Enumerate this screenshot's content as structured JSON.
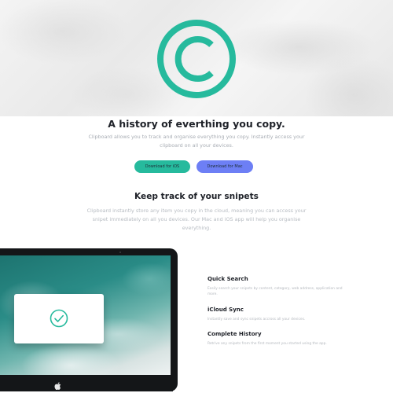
{
  "hero": {
    "logo_icon": "copyright-c-icon",
    "accent": "#26ba9d"
  },
  "intro": {
    "headline": "A history of everthing you copy.",
    "lead": "Clipboard allows you to track and organise everything you copy. Instantly access your clipboard on all your devices."
  },
  "buttons": {
    "ios_label": "Download for iOS",
    "mac_label": "Download for Mac",
    "ios_color": "#26ba9d",
    "mac_color": "#6d7ff5"
  },
  "snippets": {
    "title": "Keep track of your snipets",
    "text": "Clipboard instantly store any item you copy in the cloud, meaning you can access your snipet immediately on all you devices. Our Mac and iOS app will help you organise everything."
  },
  "device": {
    "brand_icon": "apple-icon",
    "popup_icon": "check-circle-icon"
  },
  "features": [
    {
      "title": "Quick Search",
      "text": "Easily search your snipets by content, category, web address, application and more."
    },
    {
      "title": "iCloud Sync",
      "text": "Instantly save and sync snipets accross all your devices."
    },
    {
      "title": "Complete History",
      "text": "Retrive any snipets from the first moment you started using the app."
    }
  ]
}
